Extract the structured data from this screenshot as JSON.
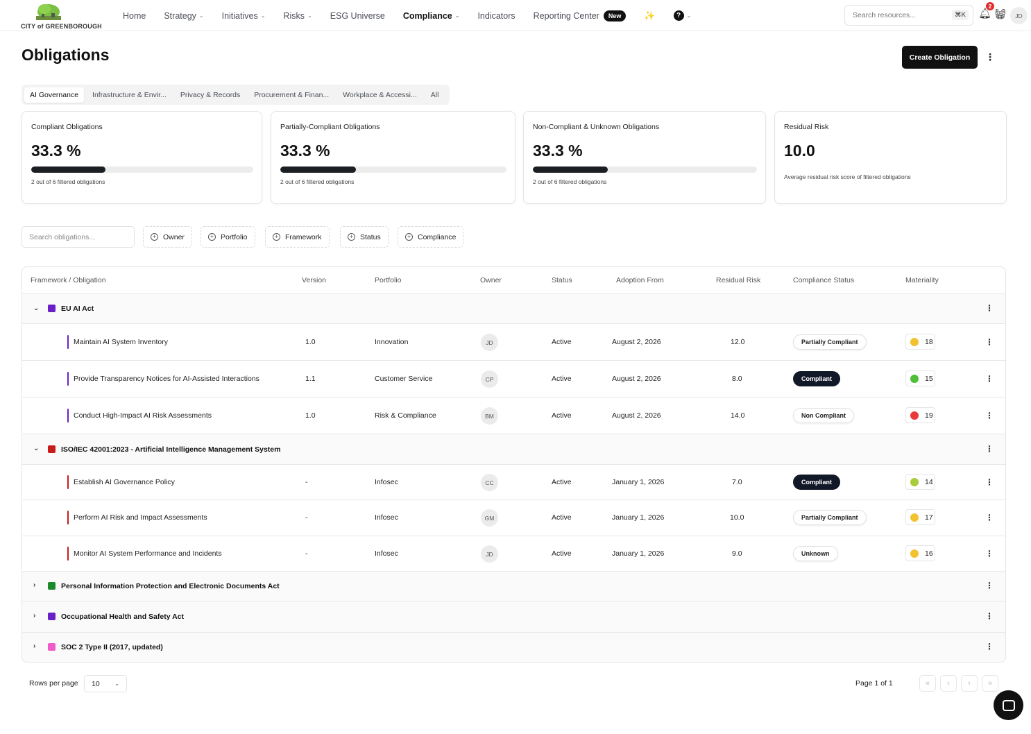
{
  "brand": {
    "logo_text": "CITY of GREENBOROUGH"
  },
  "nav": {
    "items": [
      {
        "label": "Home",
        "dropdown": false,
        "active": false
      },
      {
        "label": "Strategy",
        "dropdown": true,
        "active": false
      },
      {
        "label": "Initiatives",
        "dropdown": true,
        "active": false
      },
      {
        "label": "Risks",
        "dropdown": true,
        "active": false
      },
      {
        "label": "ESG Universe",
        "dropdown": false,
        "active": false
      },
      {
        "label": "Compliance",
        "dropdown": true,
        "active": true
      },
      {
        "label": "Indicators",
        "dropdown": false,
        "active": false
      }
    ],
    "reporting_label": "Reporting Center",
    "new_badge": "New",
    "help_glyph": "?",
    "search_placeholder": "Search resources...",
    "search_shortcut": "⌘K",
    "notification_count": "2",
    "user_initials": "JD"
  },
  "header": {
    "title": "Obligations",
    "create_button": "Create Obligation"
  },
  "tabs": [
    {
      "label": "AI Governance",
      "active": true
    },
    {
      "label": "Infrastructure & Envir...",
      "active": false
    },
    {
      "label": "Privacy & Records",
      "active": false
    },
    {
      "label": "Procurement & Finan...",
      "active": false
    },
    {
      "label": "Workplace & Accessi...",
      "active": false
    },
    {
      "label": "All",
      "active": false
    }
  ],
  "cards": [
    {
      "label": "Compliant Obligations",
      "value": "33.3 %",
      "progress": 0.333,
      "foot": "2 out of  6 filtered obligations"
    },
    {
      "label": "Partially-Compliant Obligations",
      "value": "33.3 %",
      "progress": 0.333,
      "foot": "2 out of  6 filtered obligations"
    },
    {
      "label": "Non-Compliant & Unknown Obligations",
      "value": "33.3 %",
      "progress": 0.333,
      "foot": "2 out of  6 filtered obligations"
    },
    {
      "label": "Residual Risk",
      "value": "10.0",
      "foot": "Average residual risk score of filtered obligations"
    }
  ],
  "filters": {
    "search_placeholder": "Search obligations...",
    "buttons": [
      "Owner",
      "Portfolio",
      "Framework",
      "Status",
      "Compliance"
    ]
  },
  "table": {
    "columns": [
      "Framework / Obligation",
      "Version",
      "Portfolio",
      "Owner",
      "Status",
      "Adoption From",
      "Residual Risk",
      "Compliance Status",
      "Materiality"
    ],
    "groups": [
      {
        "name": "EU AI Act",
        "color": "#6a1fc7",
        "expanded": true,
        "rows": [
          {
            "obligation": "Maintain AI System Inventory",
            "version": "1.0",
            "portfolio": "Innovation",
            "owner": "JD",
            "status": "Active",
            "adoption": "August 2, 2026",
            "risk": "12.0",
            "compliance": "Partially Compliant",
            "compliance_style": "light",
            "mat_color": "#f2c230",
            "materiality": "18"
          },
          {
            "obligation": "Provide Transparency Notices for AI-Assisted Interactions",
            "version": "1.1",
            "portfolio": "Customer Service",
            "owner": "CP",
            "status": "Active",
            "adoption": "August 2, 2026",
            "risk": "8.0",
            "compliance": "Compliant",
            "compliance_style": "dark",
            "mat_color": "#4fbf3a",
            "materiality": "15"
          },
          {
            "obligation": "Conduct High-Impact AI Risk Assessments",
            "version": "1.0",
            "portfolio": "Risk & Compliance",
            "owner": "BM",
            "status": "Active",
            "adoption": "August 2, 2026",
            "risk": "14.0",
            "compliance": "Non Compliant",
            "compliance_style": "light",
            "mat_color": "#e83a3a",
            "materiality": "19"
          }
        ]
      },
      {
        "name": "ISO/IEC 42001:2023 - Artificial Intelligence Management System",
        "color": "#c81b1b",
        "expanded": true,
        "rows": [
          {
            "obligation": "Establish AI Governance Policy",
            "version": "-",
            "portfolio": "Infosec",
            "owner": "CC",
            "status": "Active",
            "adoption": "January 1, 2026",
            "risk": "7.0",
            "compliance": "Compliant",
            "compliance_style": "dark",
            "mat_color": "#a8cc3a",
            "materiality": "14"
          },
          {
            "obligation": "Perform AI Risk and Impact Assessments",
            "version": "-",
            "portfolio": "Infosec",
            "owner": "GM",
            "status": "Active",
            "adoption": "January 1, 2026",
            "risk": "10.0",
            "compliance": "Partially Compliant",
            "compliance_style": "light",
            "mat_color": "#f2c230",
            "materiality": "17"
          },
          {
            "obligation": "Monitor AI System Performance and Incidents",
            "version": "-",
            "portfolio": "Infosec",
            "owner": "JD",
            "status": "Active",
            "adoption": "January 1, 2026",
            "risk": "9.0",
            "compliance": "Unknown",
            "compliance_style": "light",
            "mat_color": "#f2c230",
            "materiality": "16"
          }
        ]
      },
      {
        "name": "Personal Information Protection and Electronic Documents Act",
        "color": "#1a8a2a",
        "expanded": false,
        "rows": []
      },
      {
        "name": "Occupational Health and Safety Act",
        "color": "#6a1fc7",
        "expanded": false,
        "rows": []
      },
      {
        "name": "SOC 2 Type II (2017, updated)",
        "color": "#f05cc8",
        "expanded": false,
        "rows": []
      }
    ]
  },
  "pagination": {
    "rows_label": "Rows per page",
    "rows_value": "10",
    "page_label": "Page 1 of 1"
  }
}
